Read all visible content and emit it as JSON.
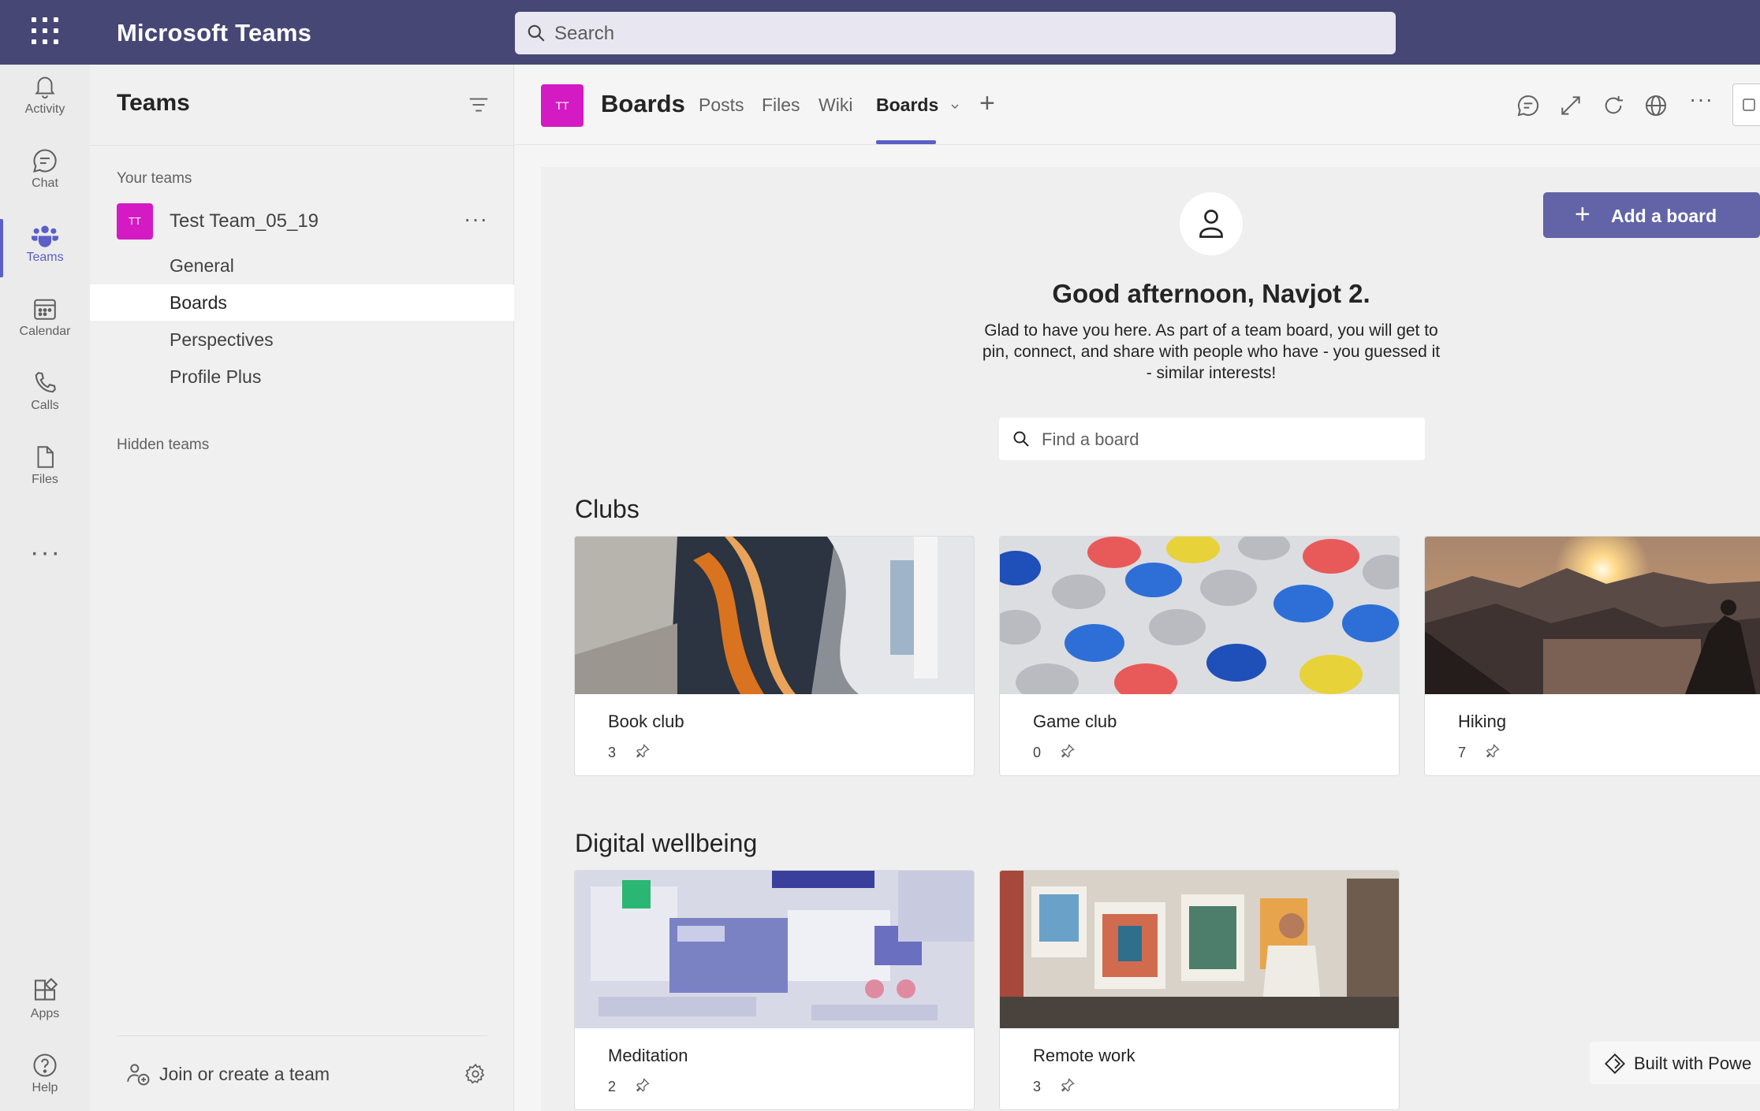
{
  "titlebar": {
    "app_title": "Microsoft Teams",
    "search_placeholder": "Search",
    "background_color": "#464775"
  },
  "rail": {
    "items": [
      {
        "label": "Activity",
        "icon": "bell-icon"
      },
      {
        "label": "Chat",
        "icon": "chat-icon"
      },
      {
        "label": "Teams",
        "icon": "teams-icon",
        "active": true
      },
      {
        "label": "Calendar",
        "icon": "calendar-icon"
      },
      {
        "label": "Calls",
        "icon": "phone-icon"
      },
      {
        "label": "Files",
        "icon": "file-icon"
      }
    ],
    "more": "···",
    "bottom_items": [
      {
        "label": "Apps",
        "icon": "apps-icon"
      },
      {
        "label": "Help",
        "icon": "help-icon"
      }
    ],
    "accent_color": "#5b5fc7"
  },
  "teams_panel": {
    "title": "Teams",
    "your_teams_label": "Your teams",
    "team": {
      "avatar": "TT",
      "name": "Test Team_05_19",
      "more": "···",
      "avatar_color": "#d41ac3"
    },
    "channels": [
      {
        "label": "General"
      },
      {
        "label": "Boards",
        "active": true
      },
      {
        "label": "Perspectives"
      },
      {
        "label": "Profile Plus"
      }
    ],
    "hidden_teams_label": "Hidden teams",
    "join_label": "Join or create a team"
  },
  "channel_header": {
    "avatar": "TT",
    "title": "Boards",
    "tabs": [
      {
        "label": "Posts"
      },
      {
        "label": "Files"
      },
      {
        "label": "Wiki"
      },
      {
        "label": "Boards",
        "active": true
      }
    ],
    "add_tab": "+",
    "more": "···"
  },
  "boards": {
    "add_board_label": "Add a board",
    "add_board_color": "#6264a7",
    "greeting": "Good afternoon, Navjot 2.",
    "intro_lines": [
      "Glad to have you here. As part of a team board, you will get to",
      "pin, connect, and share with people who have - you guessed it",
      "- similar interests!"
    ],
    "find_placeholder": "Find a board",
    "sections": [
      {
        "title": "Clubs",
        "cards": [
          {
            "name": "Book club",
            "count": "3",
            "image": "abstract-pages-image"
          },
          {
            "name": "Game club",
            "count": "0",
            "image": "colored-discs-image"
          },
          {
            "name": "Hiking",
            "count": "7",
            "image": "mountain-sunset-image"
          }
        ]
      },
      {
        "title": "Digital wellbeing",
        "cards": [
          {
            "name": "Meditation",
            "count": "2",
            "image": "dashboard-collage-image"
          },
          {
            "name": "Remote work",
            "count": "3",
            "image": "painter-studio-image"
          }
        ]
      }
    ],
    "built_with": "Built with Powe"
  }
}
